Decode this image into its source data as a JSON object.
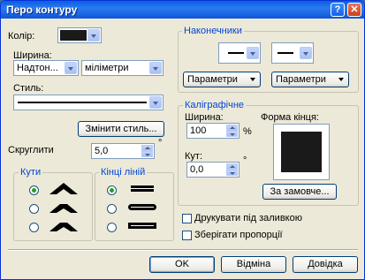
{
  "window": {
    "title": "Перо контуру",
    "help_glyph": "?",
    "close_glyph": "✕"
  },
  "color": {
    "label": "Колір:",
    "value": "#1a1a1a"
  },
  "width": {
    "label": "Ширина:",
    "weight_value": "Надтон...",
    "unit_value": "міліметри"
  },
  "style": {
    "label": "Стиль:",
    "edit_button": "Змінити стиль..."
  },
  "corners_smooth": {
    "label": "Скруглити",
    "value": "5,0",
    "unit": "°"
  },
  "corners": {
    "title": "Кути",
    "options": [
      {
        "name": "corner-miter",
        "selected": true
      },
      {
        "name": "corner-round",
        "selected": false
      },
      {
        "name": "corner-bevel",
        "selected": false
      }
    ]
  },
  "line_caps": {
    "title": "Кінці ліній",
    "options": [
      {
        "name": "cap-butt",
        "selected": true
      },
      {
        "name": "cap-round",
        "selected": false
      },
      {
        "name": "cap-square",
        "selected": false
      }
    ]
  },
  "arrows": {
    "title": "Наконечники",
    "params_left": "Параметри",
    "params_right": "Параметри"
  },
  "calligraphy": {
    "title": "Каліграфічне",
    "width_label": "Ширина:",
    "width_value": "100",
    "width_unit": "%",
    "angle_label": "Кут:",
    "angle_value": "0,0",
    "angle_unit": "°",
    "nib_label": "Форма кінця:",
    "default_button": "За замовче..."
  },
  "options": {
    "behind_fill": "Друкувати під заливкою",
    "scale_with_image": "Зберігати пропорції"
  },
  "footer": {
    "ok": "OK",
    "cancel": "Відміна",
    "help": "Довідка"
  }
}
